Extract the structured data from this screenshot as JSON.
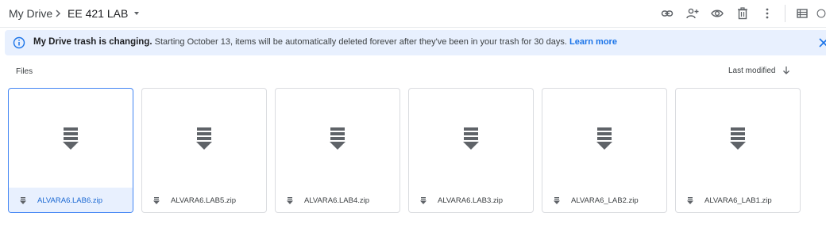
{
  "breadcrumb": {
    "root": "My Drive",
    "current": "EE 421 LAB"
  },
  "toolbar": {
    "icons": [
      "link-icon",
      "add-person-icon",
      "preview-eye-icon",
      "trash-icon",
      "more-vert-icon",
      "list-view-icon",
      "info-icon"
    ]
  },
  "banner": {
    "title": "My Drive trash is changing.",
    "message": "Starting October 13, items will be automatically deleted forever after they've been in your trash for 30 days.",
    "link": "Learn more",
    "accent": "#1a73e8",
    "background": "#e8f0fe"
  },
  "files_section": {
    "label": "Files",
    "sort_label": "Last modified"
  },
  "files": [
    {
      "name": "ALVARA6.LAB6.zip",
      "selected": true
    },
    {
      "name": "ALVARA6.LAB5.zip",
      "selected": false
    },
    {
      "name": "ALVARA6.LAB4.zip",
      "selected": false
    },
    {
      "name": "ALVARA6.LAB3.zip",
      "selected": false
    },
    {
      "name": "ALVARA6_LAB2.zip",
      "selected": false
    },
    {
      "name": "ALVARA6_LAB1.zip",
      "selected": false
    }
  ]
}
